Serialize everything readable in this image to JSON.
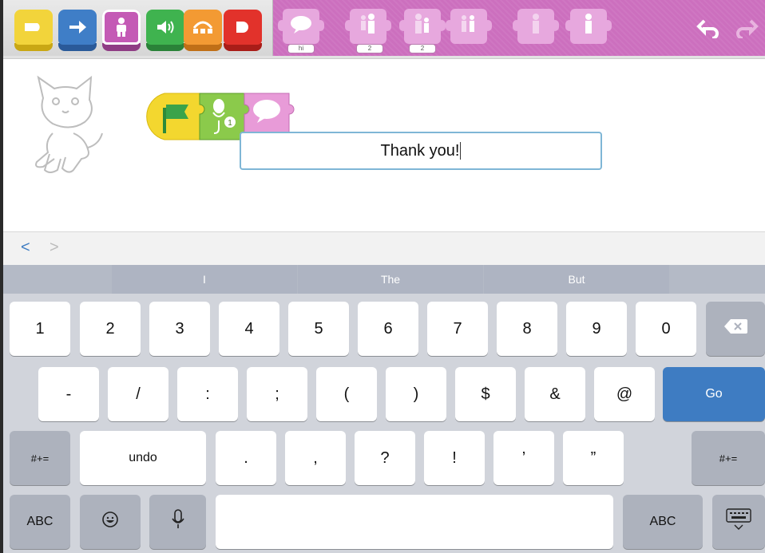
{
  "toolbar": {
    "categories": [
      {
        "name": "triggering",
        "icon": "trigger-icon",
        "color": "#f2d43b",
        "base": "#c9a714"
      },
      {
        "name": "motion",
        "icon": "arrow-right-icon",
        "color": "#3f7ec7",
        "base": "#2a5a99"
      },
      {
        "name": "looks",
        "icon": "person-icon",
        "color": "#c45ab5",
        "base": "#8f3c84"
      },
      {
        "name": "sound",
        "icon": "speaker-icon",
        "color": "#3fb34f",
        "base": "#2a8238"
      },
      {
        "name": "control",
        "icon": "loop-icon",
        "color": "#f39a33",
        "base": "#c06f17"
      },
      {
        "name": "end",
        "icon": "end-icon",
        "color": "#e2322b",
        "base": "#a91d18"
      }
    ],
    "palette_blocks": [
      {
        "icon": "speech-bubble-icon",
        "tag": "hi"
      },
      {
        "icon": "grow-icon",
        "tag": "2"
      },
      {
        "icon": "shrink-icon",
        "tag": "2"
      },
      {
        "icon": "reset-size-icon",
        "tag": ""
      },
      {
        "icon": "hide-icon",
        "tag": ""
      },
      {
        "icon": "show-icon",
        "tag": ""
      }
    ]
  },
  "script": {
    "blocks": [
      "green-flag-icon",
      "record-sound-icon",
      "say-icon"
    ],
    "sound_number": "1"
  },
  "text_input": {
    "value": "Thank you!"
  },
  "keyboard": {
    "nav": {
      "back": "<",
      "forward": ">"
    },
    "suggestions": [
      "I",
      "The",
      "But"
    ],
    "row1": [
      "1",
      "2",
      "3",
      "4",
      "5",
      "6",
      "7",
      "8",
      "9",
      "0"
    ],
    "row2": [
      "-",
      "/",
      ":",
      ";",
      "(",
      ")",
      "$",
      "&",
      "@"
    ],
    "go": "Go",
    "symbols_left": "#+=",
    "undo": "undo",
    "row3": [
      ".",
      ",",
      "?",
      "!",
      "’",
      "”"
    ],
    "symbols_right": "#+=",
    "abc_left": "ABC",
    "abc_right": "ABC"
  }
}
